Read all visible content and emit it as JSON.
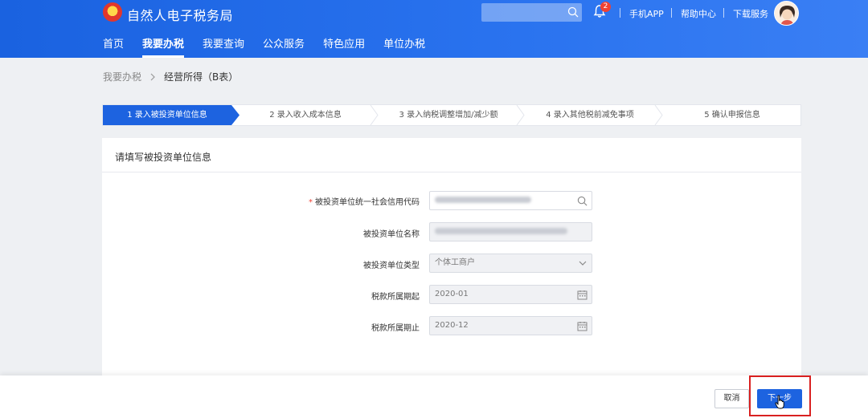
{
  "header": {
    "app_title": "自然人电子税务局",
    "notification_count": "2",
    "links": [
      "手机APP",
      "帮助中心",
      "下载服务"
    ],
    "nav": [
      {
        "label": "首页",
        "active": false
      },
      {
        "label": "我要办税",
        "active": true
      },
      {
        "label": "我要查询",
        "active": false
      },
      {
        "label": "公众服务",
        "active": false
      },
      {
        "label": "特色应用",
        "active": false
      },
      {
        "label": "单位办税",
        "active": false
      }
    ]
  },
  "breadcrumb": {
    "parent": "我要办税",
    "current": "经营所得（B表）"
  },
  "steps": [
    "1 录入被投资单位信息",
    "2 录入收入成本信息",
    "3 录入纳税调整增加/减少额",
    "4 录入其他税前减免事项",
    "5 确认申报信息"
  ],
  "active_step": 1,
  "form": {
    "title": "请填写被投资单位信息",
    "fields": [
      {
        "label": "被投资单位统一社会信用代码",
        "required": true,
        "value": "",
        "redacted": true
      },
      {
        "label": "被投资单位名称",
        "required": false,
        "value": "",
        "redacted": true
      },
      {
        "label": "被投资单位类型",
        "required": false,
        "value": "个体工商户"
      },
      {
        "label": "税款所属期起",
        "required": false,
        "value": "2020-01"
      },
      {
        "label": "税款所属期止",
        "required": false,
        "value": "2020-12"
      }
    ]
  },
  "footer": {
    "cancel_label": "取消",
    "next_label": "下一步"
  },
  "colors": {
    "brand_blue": "#1d63e0",
    "highlight_red": "#d92020"
  }
}
